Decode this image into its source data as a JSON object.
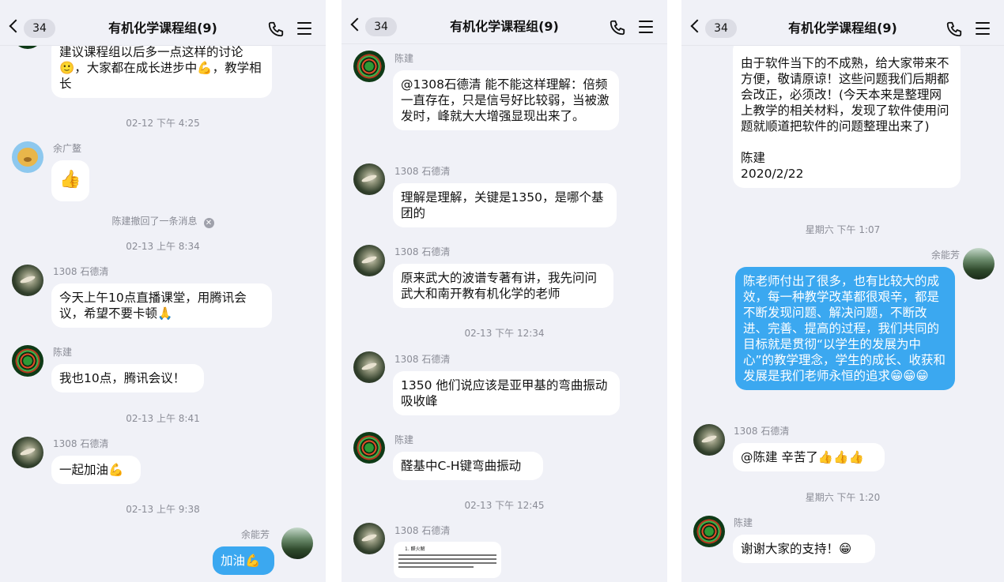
{
  "header": {
    "back_count": "34",
    "title": "有机化学课程组(9)"
  },
  "panel1": {
    "m1_text": "建议课程组以后多一点这样的讨论🙂，大家都在成长进步中💪，教学相长",
    "t1": "02-12 下午 4:25",
    "m2_name": "余广鳌",
    "m2_text": "👍",
    "recall": "陈建撤回了一条消息",
    "t2": "02-13 上午 8:34",
    "m3_name": "1308 石德清",
    "m3_text": "今天上午10点直播课堂，用腾讯会议，希望不要卡顿🙏",
    "m4_name": "陈建",
    "m4_text": "我也10点，腾讯会议！",
    "t3": "02-13 上午 8:41",
    "m5_name": "1308 石德清",
    "m5_text": "一起加油💪",
    "t4": "02-13 上午 9:38",
    "m6_name": "余能芳",
    "m6_text": "加油💪"
  },
  "panel2": {
    "m1_name": "陈建",
    "m1_text": "@1308石德清 能不能这样理解：倍频一直存在，只是信号好比较弱，当被激发时，峰就大大增强显现出来了。",
    "m2_name": "1308 石德清",
    "m2_text": "理解是理解，关键是1350，是哪个基团的",
    "m3_name": "1308 石德清",
    "m3_text": "原来武大的波谱专著有讲，我先问问武大和南开教有机化学的老师",
    "t1": "02-13 下午 12:34",
    "m4_name": "1308 石德清",
    "m4_text": "1350 他们说应该是亚甲基的弯曲振动吸收峰",
    "m5_name": "陈建",
    "m5_text": "醛基中C-H键弯曲振动",
    "t2": "02-13 下午 12:45",
    "m6_name": "1308 石德清",
    "m6_image_title": "1. 醛火解"
  },
  "panel3": {
    "m1_text": "由于软件当下的不成熟，给大家带来不方便，敬请原谅！这些问题我们后期都会改正，必须改！(今天本来是整理网上教学的相关材料，发现了软件使用问题就顺道把软件的问题整理出来了)",
    "m1_sign": "陈建",
    "m1_date": "2020/2/22",
    "t1": "星期六 下午 1:07",
    "m2_name": "余能芳",
    "m2_text": "陈老师付出了很多，也有比较大的成效，每一种教学改革都很艰辛，都是不断发现问题、解决问题，不断改进、完善、提高的过程，我们共同的目标就是贯彻“以学生的发展为中心”的教学理念，学生的成长、收获和发展是我们老师永恒的追求😁😁😁",
    "m3_name": "1308 石德清",
    "m3_text": "@陈建 辛苦了👍👍👍",
    "t2": "星期六 下午 1:20",
    "m4_name": "陈建",
    "m4_text": "谢谢大家的支持！😁"
  },
  "icons": {
    "back": "chevron-left-icon",
    "phone": "phone-icon",
    "menu": "menu-icon"
  }
}
